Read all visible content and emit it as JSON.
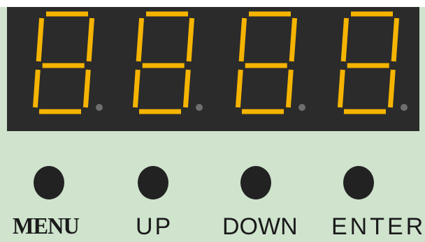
{
  "display": {
    "digits": [
      "segment-digit-1",
      "segment-digit-2",
      "segment-digit-3",
      "segment-digit-4"
    ],
    "segment_color": "#f5b400",
    "background_color": "#2b2b2b",
    "decimal_point_color": "#6e6e6e"
  },
  "panel": {
    "background_color": "#cfe3cd"
  },
  "buttons": [
    {
      "label": "MENU"
    },
    {
      "label": "UP"
    },
    {
      "label": "DOWN"
    },
    {
      "label": "ENTER"
    }
  ]
}
